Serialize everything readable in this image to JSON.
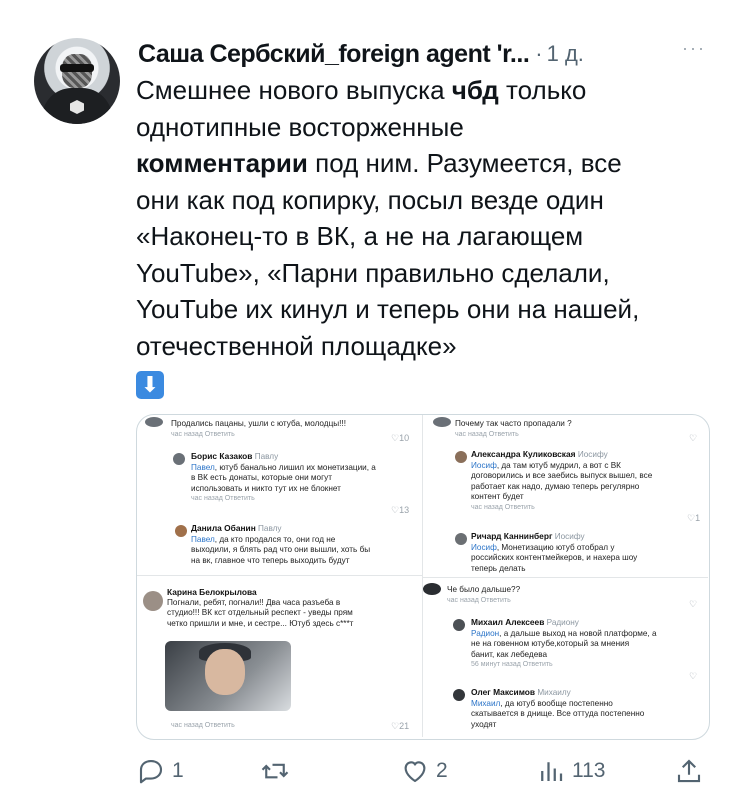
{
  "author": {
    "name": "Саша Сербский_foreign agent 'r...",
    "separator": "·",
    "time": "1 д.",
    "more": "···"
  },
  "tweet": {
    "line1_a": "Смешнее нового выпуска ",
    "line1_b": "чбд",
    "line1_c": " только",
    "line2": "однотипные восторженные",
    "line3_a": "комментарии",
    "line3_b": " под ним. Разумеется, все",
    "line4": "они как под копирку, посыл везде один",
    "line5": "«Наконец-то в ВК, а не на лагающем",
    "line6": "YouTube», «Парни правильно сделали,",
    "line7": "YouTube их кинул и теперь они на нашей,",
    "line8": "отечественной площадке»",
    "emoji": "⬇"
  },
  "media": {
    "left": {
      "c1": {
        "text": "Продались пацаны, ушли с ютуба, молодцы!!!",
        "meta": "час назад   Ответить",
        "likes": "♡10"
      },
      "c2": {
        "user": "Борис Казаков",
        "to": "Павлу",
        "mention": "Павел",
        "text1": ", ютуб банально лишил их монетизации, а",
        "text2": "в ВК есть донаты, которые они могут",
        "text3": "использовать и никто тут их не блокнет",
        "meta": "час назад   Ответить",
        "likes": "♡13"
      },
      "c3": {
        "user": "Данила Обанин",
        "to": "Павлу",
        "mention": "Павел",
        "text1": ", да кто продался то, они год не",
        "text2": "выходили, я блять рад что они вышли, хоть бы",
        "text3": "на вк, главное что теперь выходить будут"
      },
      "c4": {
        "user": "Карина Белокрылова",
        "text1": "Погнали, ребят, погнали!! Два часа разъеба в",
        "text2": "студио!!! ВК кст отдельный респект - уведы прям",
        "text3": "четко пришли и мне, и сестре... Ютуб здесь с***т",
        "meta": "час назад   Ответить",
        "likes": "♡21"
      }
    },
    "right": {
      "c1": {
        "text": "Почему так часто пропадали ?",
        "meta": "час назад   Ответить",
        "likes": "♡"
      },
      "c2": {
        "user": "Александра Куликовская",
        "to": "Иосифу",
        "mention": "Иосиф",
        "text1": ", да там ютуб мудрил, а вот с ВК",
        "text2": "договорились и все заебись выпуск вышел, все",
        "text3": "работает как надо, думаю теперь регулярно",
        "text4": "контент будет",
        "meta": "час назад   Ответить",
        "likes": "♡1"
      },
      "c3": {
        "user": "Ричард Каннинберг",
        "to": "Иосифу",
        "mention": "Иосиф",
        "text1": ", Монетизацию ютуб отобрал у",
        "text2": "российских контентмейкеров, и нахера шоу",
        "text3": "теперь делать"
      },
      "c4": {
        "text": "Че было дальше??",
        "meta": "час назад   Ответить",
        "likes": "♡"
      },
      "c5": {
        "user": "Михаил Алексеев",
        "to": "Радиону",
        "mention": "Радион",
        "text1": ", а дальше выход на новой платформе, а",
        "text2": "не на говенном ютубе,который за мнения",
        "text3": "банит, как лебедева",
        "meta": "56 минут назад   Ответить",
        "likes": "♡"
      },
      "c6": {
        "user": "Олег Максимов",
        "to": "Михаилу",
        "mention": "Михаил",
        "text1": ", да ютуб вообще постепенно",
        "text2": "скатывается в днище. Все оттуда постепенно",
        "text3": "уходят"
      }
    }
  },
  "actions": {
    "reply_count": "1",
    "retweet_count": "",
    "like_count": "2",
    "views_count": "113"
  },
  "colors": {
    "accent": "#1d9bf0",
    "muted": "#536471",
    "mention": "#2b74c8"
  }
}
